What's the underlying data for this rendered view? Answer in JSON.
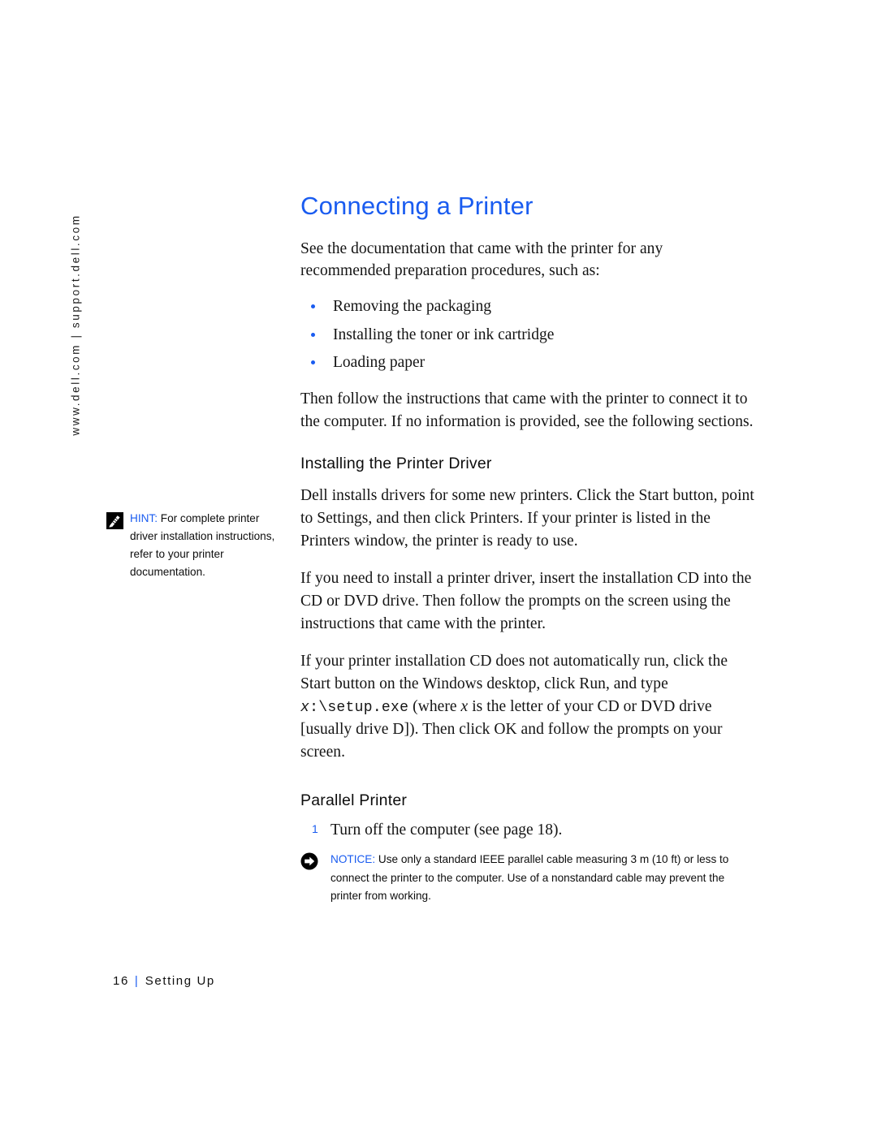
{
  "sidebar": {
    "rail_text": "www.dell.com | support.dell.com"
  },
  "main": {
    "title": "Connecting a Printer",
    "intro": "See the documentation that came with the printer for any recommended preparation procedures, such as:",
    "bullets": [
      "Removing the packaging",
      "Installing the toner or ink cartridge",
      "Loading paper"
    ],
    "after_bullets": "Then follow the instructions that came with the printer to connect it to the computer. If no information is provided, see the following sections.",
    "section_driver": {
      "heading": "Installing the Printer Driver",
      "para1": "Dell installs drivers for some new printers. Click the Start button, point to Settings, and then click Printers. If your printer is listed in the Printers window, the printer is ready to use.",
      "para2": "If you need to install a printer driver, insert the installation CD into the CD or DVD drive. Then follow the prompts on the screen using the instructions that came with the printer.",
      "para3_a": "If your printer installation CD does not automatically run, click the Start button on the Windows desktop, click Run, and type",
      "para3_code_var": "x",
      "para3_code_rest": ":\\setup.exe",
      "para3_b_pre": "(where",
      "para3_b_var": "x",
      "para3_b_post": "is the letter of your CD or DVD drive [usually drive D]). Then click OK and follow the prompts on your screen."
    },
    "section_parallel": {
      "heading": "Parallel Printer",
      "steps": [
        {
          "number": "1",
          "text": "Turn off the computer (see page 18)."
        }
      ],
      "notice": {
        "icon": "arrow-right-circle-icon",
        "label": "NOTICE:",
        "text": "Use only a standard IEEE parallel cable measuring 3 m (10 ft) or less to connect the printer to the computer. Use of a nonstandard cable may prevent the printer from working."
      }
    }
  },
  "hint": {
    "icon": "pencil-note-icon",
    "label": "HINT:",
    "text": "For complete printer driver installation instructions, refer to your printer documentation."
  },
  "footer": {
    "page_number": "16",
    "separator": "|",
    "chapter": "Setting Up"
  },
  "colors": {
    "accent_blue": "#1a5cf0",
    "body_black": "#141414",
    "page_background": "#ffffff"
  }
}
